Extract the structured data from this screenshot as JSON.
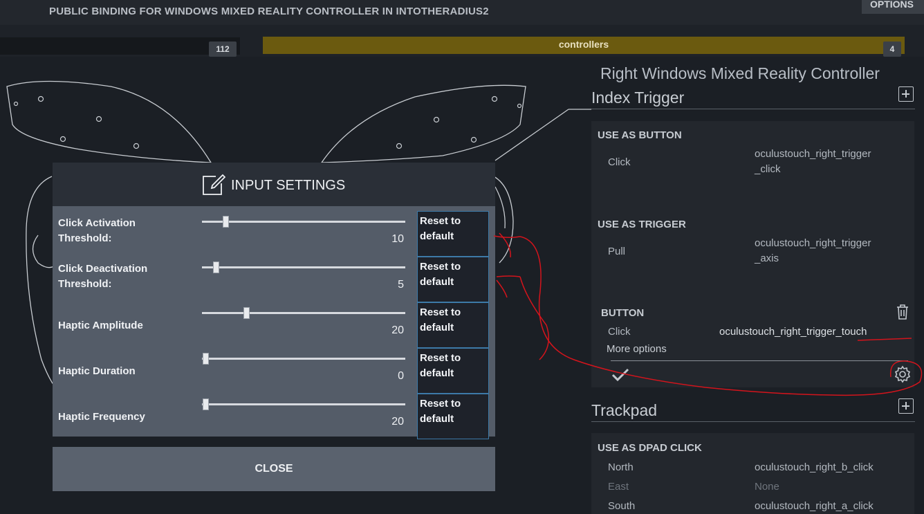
{
  "window": {
    "title": "PUBLIC BINDING FOR WINDOWS MIXED REALITY CONTROLLER IN INTOTHERADIUS2",
    "options_label": "OPTIONS"
  },
  "tabs": {
    "left_badge": "112",
    "controllers_label": "controllers",
    "controllers_badge": "4"
  },
  "panel": {
    "title": "Right Windows Mixed Reality Controller",
    "index_trigger": {
      "heading": "Index Trigger",
      "use_as_button": {
        "heading": "USE AS BUTTON",
        "click_label": "Click",
        "click_value_1": "oculustouch_right_trigger",
        "click_value_2": "_click"
      },
      "use_as_trigger": {
        "heading": "USE AS TRIGGER",
        "pull_label": "Pull",
        "pull_value_1": "oculustouch_right_trigger",
        "pull_value_2": "_axis"
      },
      "button": {
        "heading": "BUTTON",
        "click_label": "Click",
        "click_value": "oculustouch_right_trigger_touch",
        "more_options": "More options"
      }
    },
    "trackpad": {
      "heading": "Trackpad",
      "dpad": {
        "heading": "USE AS DPAD CLICK",
        "rows": [
          {
            "label": "North",
            "value": "oculustouch_right_b_click",
            "muted": false
          },
          {
            "label": "East",
            "value": "None",
            "muted": true
          },
          {
            "label": "South",
            "value": "oculustouch_right_a_click",
            "muted": false
          }
        ]
      }
    }
  },
  "modal": {
    "title": "INPUT SETTINGS",
    "reset_label_1": "Reset to",
    "reset_label_2": "default",
    "close_label": "CLOSE",
    "settings": [
      {
        "label_1": "Click Activation",
        "label_2": "Threshold:",
        "value": "10",
        "fraction": 0.1
      },
      {
        "label_1": "Click Deactivation",
        "label_2": "Threshold:",
        "value": "5",
        "fraction": 0.05
      },
      {
        "label_1": "Haptic Amplitude",
        "label_2": "",
        "value": "20",
        "fraction": 0.2
      },
      {
        "label_1": "Haptic Duration",
        "label_2": "",
        "value": "0",
        "fraction": 0.0
      },
      {
        "label_1": "Haptic Frequency",
        "label_2": "",
        "value": "20",
        "fraction": 0.0
      }
    ]
  },
  "colors": {
    "controllers_tab": "#6b5a0f",
    "annotation_red": "#d4141c",
    "modal_body": "#545c68",
    "reset_border": "#3d7aa8"
  }
}
